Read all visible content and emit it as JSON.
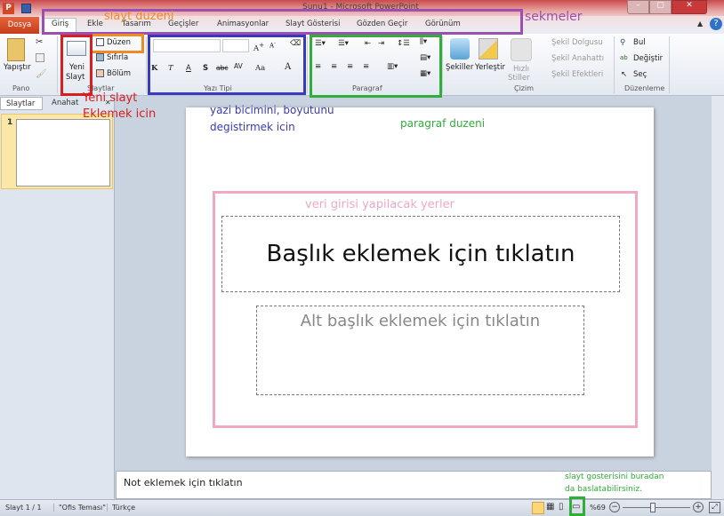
{
  "window": {
    "title": "Sunu1 - Microsoft PowerPoint"
  },
  "tabs": {
    "file": "Dosya",
    "items": [
      "Giriş",
      "Ekle",
      "Tasarım",
      "Geçişler",
      "Animasyonlar",
      "Slayt Gösterisi",
      "Gözden Geçir",
      "Görünüm"
    ]
  },
  "ribbon": {
    "pano": {
      "paste": "Yapıştır",
      "label": "Pano"
    },
    "slaytlar": {
      "new_slide_1": "Yeni",
      "new_slide_2": "Slayt",
      "layout": "Düzen",
      "reset": "Sıfırla",
      "section": "Bölüm",
      "label": "Slaytlar"
    },
    "font": {
      "label": "Yazı Tipi",
      "bold": "K",
      "italic": "T",
      "underline": "A",
      "shadow": "S",
      "strike": "abc",
      "spacing": "AV",
      "case": "Aa",
      "color": "A"
    },
    "paragraph": {
      "label": "Paragraf"
    },
    "drawing": {
      "shapes": "Şekiller",
      "arrange": "Yerleştir",
      "quick_1": "Hızlı",
      "quick_2": "Stiller",
      "fill": "Şekil Dolgusu",
      "outline": "Şekil Anahattı",
      "effects": "Şekil Efektleri",
      "label": "Çizim"
    },
    "editing": {
      "find": "Bul",
      "replace": "Değiştir",
      "select": "Seç",
      "label": "Düzenleme"
    }
  },
  "left_panel": {
    "tab_slides": "Slaytlar",
    "tab_outline": "Anahat",
    "slide_number": "1"
  },
  "slide": {
    "title_placeholder": "Başlık eklemek için tıklatın",
    "subtitle_placeholder": "Alt başlık eklemek için tıklatın"
  },
  "notes": {
    "placeholder": "Not eklemek için tıklatın"
  },
  "status": {
    "slide": "Slayt 1 / 1",
    "theme": "\"Ofis Teması\"",
    "language": "Türkçe",
    "zoom": "%69",
    "zoom_level": 0.45
  },
  "annotations": {
    "tabs": "sekmeler",
    "layout": "slayt duzeni",
    "new_slide_1": "Yeni slayt",
    "new_slide_2": "Eklemek icin",
    "font_1": "yazi bicimini, boyutunu",
    "font_2": "degistirmek icin",
    "paragraph": "paragraf duzeni",
    "placeholders": "veri girisi yapilacak yerler",
    "slideshow_1": "slayt gosterisini buradan",
    "slideshow_2": "da baslatabilirsiniz."
  },
  "colors": {
    "purple": "#9b4fb0",
    "orange": "#f08a24",
    "red": "#d42020",
    "blue": "#3a3ab8",
    "green": "#2fae3a",
    "pink": "#f0a8c4"
  }
}
